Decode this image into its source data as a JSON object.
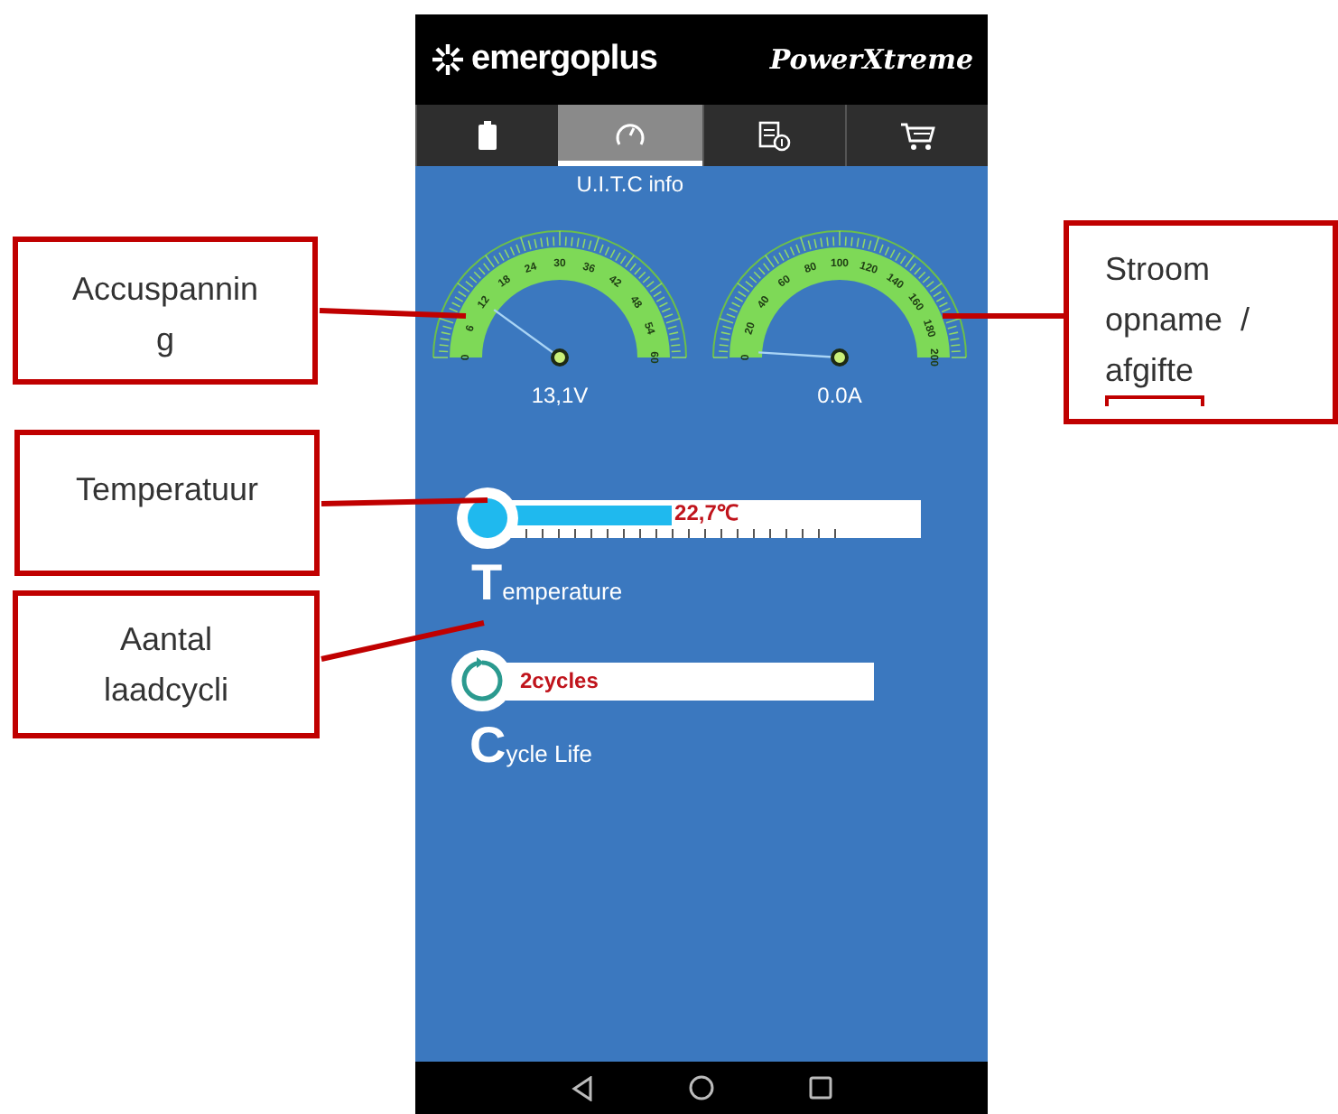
{
  "header": {
    "brand": "emergoplus",
    "product": "PowerXtreme"
  },
  "tabs": [
    {
      "selected": false
    },
    {
      "selected": true
    },
    {
      "selected": false
    },
    {
      "selected": false
    }
  ],
  "section_title": "U.I.T.C info",
  "gauges": [
    {
      "ticks": [
        "0",
        "6",
        "12",
        "18",
        "24",
        "30",
        "36",
        "42",
        "48",
        "54",
        "60"
      ],
      "reading": "13,1V"
    },
    {
      "ticks": [
        "0",
        "20",
        "40",
        "60",
        "80",
        "100",
        "120",
        "140",
        "160",
        "180",
        "200"
      ],
      "reading": "0.0A"
    }
  ],
  "temperature": {
    "level": 0.39,
    "reading": "22,7℃",
    "initial": "T",
    "label": "emperature"
  },
  "cycles": {
    "reading": "2cycles",
    "initial": "C",
    "label": "ycle Life"
  },
  "callouts": [
    {
      "lines": [
        "Accuspannin",
        "g"
      ]
    },
    {
      "lines": [
        "Temperatuur"
      ]
    },
    {
      "lines": [
        "Aantal",
        "laadcycli"
      ]
    },
    {
      "lines": [
        "Stroom",
        "opname  /",
        "afgifte"
      ]
    }
  ]
}
